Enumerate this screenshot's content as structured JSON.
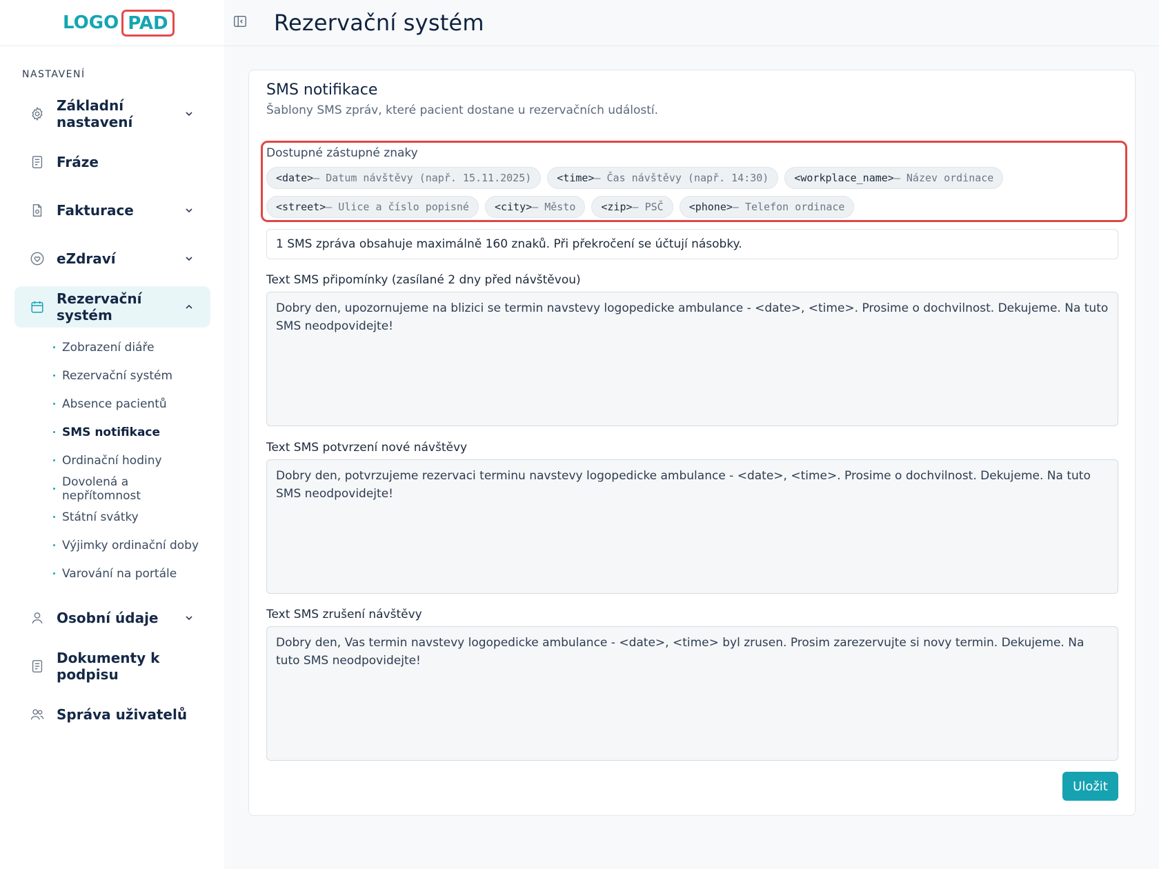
{
  "logo": {
    "part1": "LOGO",
    "part2": "PAD"
  },
  "sidebar": {
    "section_label": "NASTAVENÍ",
    "items": [
      {
        "label": "Základní nastavení",
        "icon": "gear-icon"
      },
      {
        "label": "Fráze",
        "icon": "document-icon"
      },
      {
        "label": "Fakturace",
        "icon": "invoice-icon"
      },
      {
        "label": "eZdraví",
        "icon": "heart-icon"
      },
      {
        "label": "Rezervační systém",
        "icon": "calendar-icon"
      },
      {
        "label": "Osobní údaje",
        "icon": "user-icon"
      },
      {
        "label": "Dokumenty k podpisu",
        "icon": "document-icon"
      },
      {
        "label": "Správa uživatelů",
        "icon": "users-icon"
      }
    ],
    "sub_items": [
      "Zobrazení diáře",
      "Rezervační systém",
      "Absence pacientů",
      "SMS notifikace",
      "Ordinační hodiny",
      "Dovolená a nepřítomnost",
      "Státní svátky",
      "Výjimky ordinační doby",
      "Varování na portále"
    ]
  },
  "header": {
    "title": "Rezervační systém"
  },
  "card": {
    "title": "SMS notifikace",
    "subtitle": "Šablony SMS zpráv, které pacient dostane u rezervačních událostí.",
    "placeholders_title": "Dostupné zástupné znaky",
    "placeholders": [
      {
        "tag": "<date>",
        "desc": "– Datum návštěvy (např. 15.11.2025)"
      },
      {
        "tag": "<time>",
        "desc": "– Čas návštěvy (např. 14:30)"
      },
      {
        "tag": "<workplace_name>",
        "desc": "– Název ordinace"
      },
      {
        "tag": "<street>",
        "desc": "– Ulice a číslo popisné"
      },
      {
        "tag": "<city>",
        "desc": "– Město"
      },
      {
        "tag": "<zip>",
        "desc": "– PSČ"
      },
      {
        "tag": "<phone>",
        "desc": "– Telefon ordinace"
      }
    ],
    "info": "1 SMS zpráva obsahuje maximálně 160 znaků. Při překročení se účtují násobky.",
    "fields": [
      {
        "label": "Text SMS připomínky (zasílané 2 dny před návštěvou)",
        "value": "Dobry den, upozornujeme na blizici se termin navstevy logopedicke ambulance - <date>, <time>. Prosime o dochvilnost. Dekujeme. Na tuto SMS neodpovidejte!"
      },
      {
        "label": "Text SMS potvrzení nové návštěvy",
        "value": "Dobry den, potvrzujeme rezervaci terminu navstevy logopedicke ambulance - <date>, <time>. Prosime o dochvilnost. Dekujeme. Na tuto SMS neodpovidejte!"
      },
      {
        "label": "Text SMS zrušení návštěvy",
        "value": "Dobry den, Vas termin navstevy logopedicke ambulance - <date>, <time> byl zrusen. Prosim zarezervujte si novy termin. Dekujeme. Na tuto SMS neodpovidejte!"
      }
    ],
    "save_label": "Uložit"
  },
  "colors": {
    "accent": "#16a2b1",
    "highlight": "#e04646",
    "logo_frame": "#e24b4b"
  }
}
